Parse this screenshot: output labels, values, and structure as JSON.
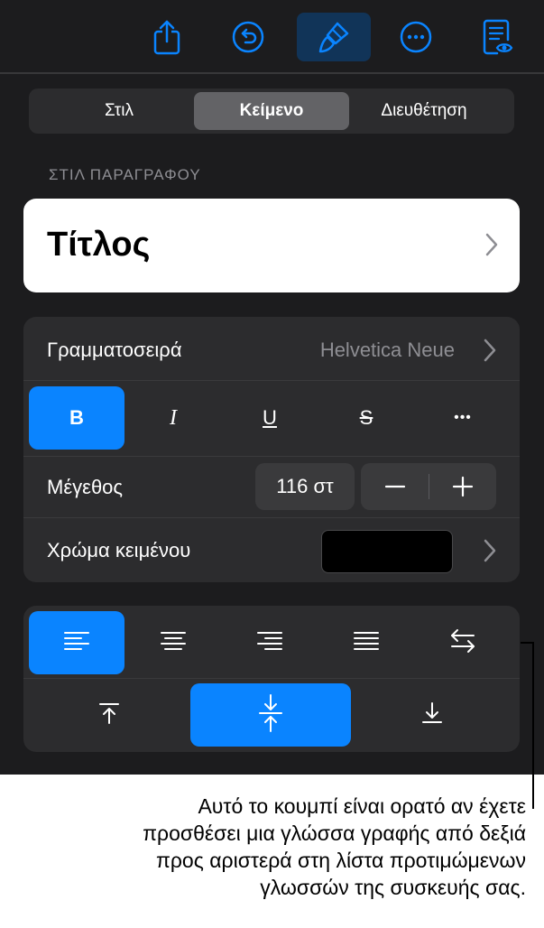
{
  "toolbar": {
    "buttons": [
      {
        "icon": "share-icon",
        "active": false
      },
      {
        "icon": "undo-icon",
        "active": false
      },
      {
        "icon": "paintbrush-icon",
        "active": true
      },
      {
        "icon": "more-icon",
        "active": false
      },
      {
        "icon": "document-preview-icon",
        "active": false
      }
    ]
  },
  "tabs": {
    "style": "Στιλ",
    "text": "Κείμενο",
    "arrange": "Διευθέτηση",
    "selected": "Κείμενο"
  },
  "paragraph": {
    "header": "ΣΤΙΛ ΠΑΡΑΓΡΑΦΟΥ",
    "style_name": "Τίτλος"
  },
  "font": {
    "label": "Γραμματοσειρά",
    "value": "Helvetica Neue",
    "bold": "B",
    "italic": "I",
    "underline": "U",
    "strikethrough": "S",
    "more": "•••",
    "bold_on": true
  },
  "size": {
    "label": "Μέγεθος",
    "value": "116 στ",
    "minus": "−",
    "plus": "+"
  },
  "color": {
    "label": "Χρώμα κειμένου",
    "swatch": "#000000"
  },
  "alignment": {
    "horizontal": [
      "align-left",
      "align-center",
      "align-right",
      "justify",
      "right-to-left"
    ],
    "horizontal_selected": "align-left",
    "vertical": [
      "align-top",
      "align-middle",
      "align-bottom"
    ],
    "vertical_selected": "align-middle"
  },
  "caption": {
    "line1": "Αυτό το κουμπί είναι ορατό αν έχετε",
    "line2": "προσθέσει μια γλώσσα γραφής από δεξιά",
    "line3": "προς αριστερά στη λίστα προτιμώμενων",
    "line4": "γλωσσών της συσκευής σας."
  },
  "colors": {
    "panel": "#1c1c1e",
    "group": "#2c2c2e",
    "accent": "#0a84ff",
    "muted": "#8e8e93"
  }
}
